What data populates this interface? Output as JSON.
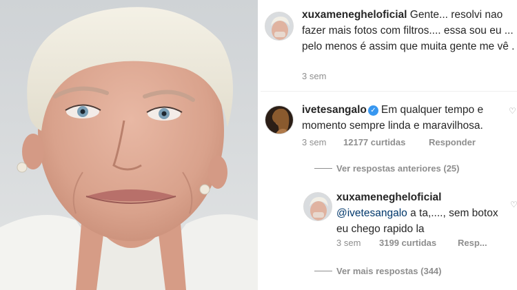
{
  "post": {
    "username": "xuxameneghel​oficial",
    "caption": "Gente... resolvi nao fazer mais fotos com filtros.... essa sou eu ... pelo menos é assim que muita gente me vê .",
    "time": "3 sem"
  },
  "comment": {
    "username": "ivetesangalo",
    "text": "Em qualquer tempo e momento sempre linda e maravilhosa.",
    "time": "3 sem",
    "likes": "12177 curtidas",
    "reply_label": "Responder",
    "view_previous": "Ver respostas anteriores (25)"
  },
  "reply": {
    "username": "xuxameneghel​oficial",
    "mention": "@ivetesangalo",
    "text": " a ta,...., sem botox eu chego rapido la",
    "time": "3 sem",
    "likes": "3199 curtidas",
    "reply_label": "Resp...",
    "view_more": "Ver mais respostas (344)"
  },
  "colors": {
    "text": "#262626",
    "muted": "#8e8e8e",
    "mention": "#00376b",
    "verified": "#3897f0"
  },
  "icons": [
    "heart-icon",
    "verified-badge-icon"
  ]
}
